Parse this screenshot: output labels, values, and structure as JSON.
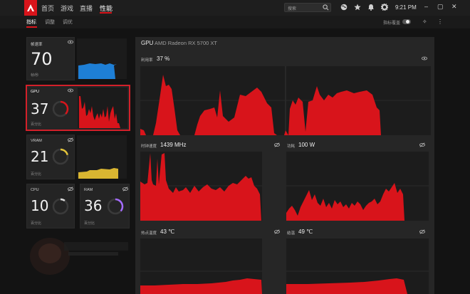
{
  "nav": {
    "items": [
      "首页",
      "游戏",
      "直播",
      "性能"
    ],
    "active": "性能",
    "search_placeholder": "搜索",
    "time": "9:21 PM"
  },
  "subnav": {
    "items": [
      "指标",
      "调整",
      "调优"
    ],
    "active": "指标",
    "overlay_label": "指标覆盖"
  },
  "tiles": {
    "fps": {
      "label": "帧速率",
      "value": "70",
      "unit": "帧/秒"
    },
    "gpu": {
      "label": "GPU",
      "value": "37",
      "unit": "百分比",
      "gauge": 0.37
    },
    "vram": {
      "label": "VRAM",
      "value": "21",
      "unit": "百分比",
      "gauge": 0.21
    },
    "cpu": {
      "label": "CPU",
      "value": "10",
      "unit": "百分比",
      "gauge": 0.1
    },
    "ram": {
      "label": "RAM",
      "value": "36",
      "unit": "百分比",
      "gauge": 0.36
    }
  },
  "main": {
    "title": "GPU",
    "subtitle": "AMD Radeon RX 5700 XT",
    "utilization": {
      "label": "利用率",
      "value": "37 %"
    },
    "clock": {
      "label": "时钟速度",
      "value": "1439 MHz"
    },
    "power": {
      "label": "功耗",
      "value": "100 W"
    },
    "temp": {
      "label": "热点温度",
      "value": "43 ℃"
    },
    "junction": {
      "label": "结温",
      "value": "49 ℃"
    }
  },
  "colors": {
    "accent": "#d8141b",
    "fps_graph": "#1e7fd6",
    "vram_graph": "#d9b531",
    "gpu_gauge": "#d8141b",
    "vram_gauge": "#e3c43a",
    "cpu_gauge": "#dcdcdc",
    "ram_gauge": "#a46bff"
  },
  "icons": [
    "amd-logo-icon",
    "globe-icon",
    "star-icon",
    "bell-icon",
    "gear-icon",
    "search-icon",
    "eye-icon",
    "eye-off-icon",
    "minimize-icon",
    "maximize-icon",
    "close-icon",
    "bug-icon",
    "more-icon"
  ]
}
